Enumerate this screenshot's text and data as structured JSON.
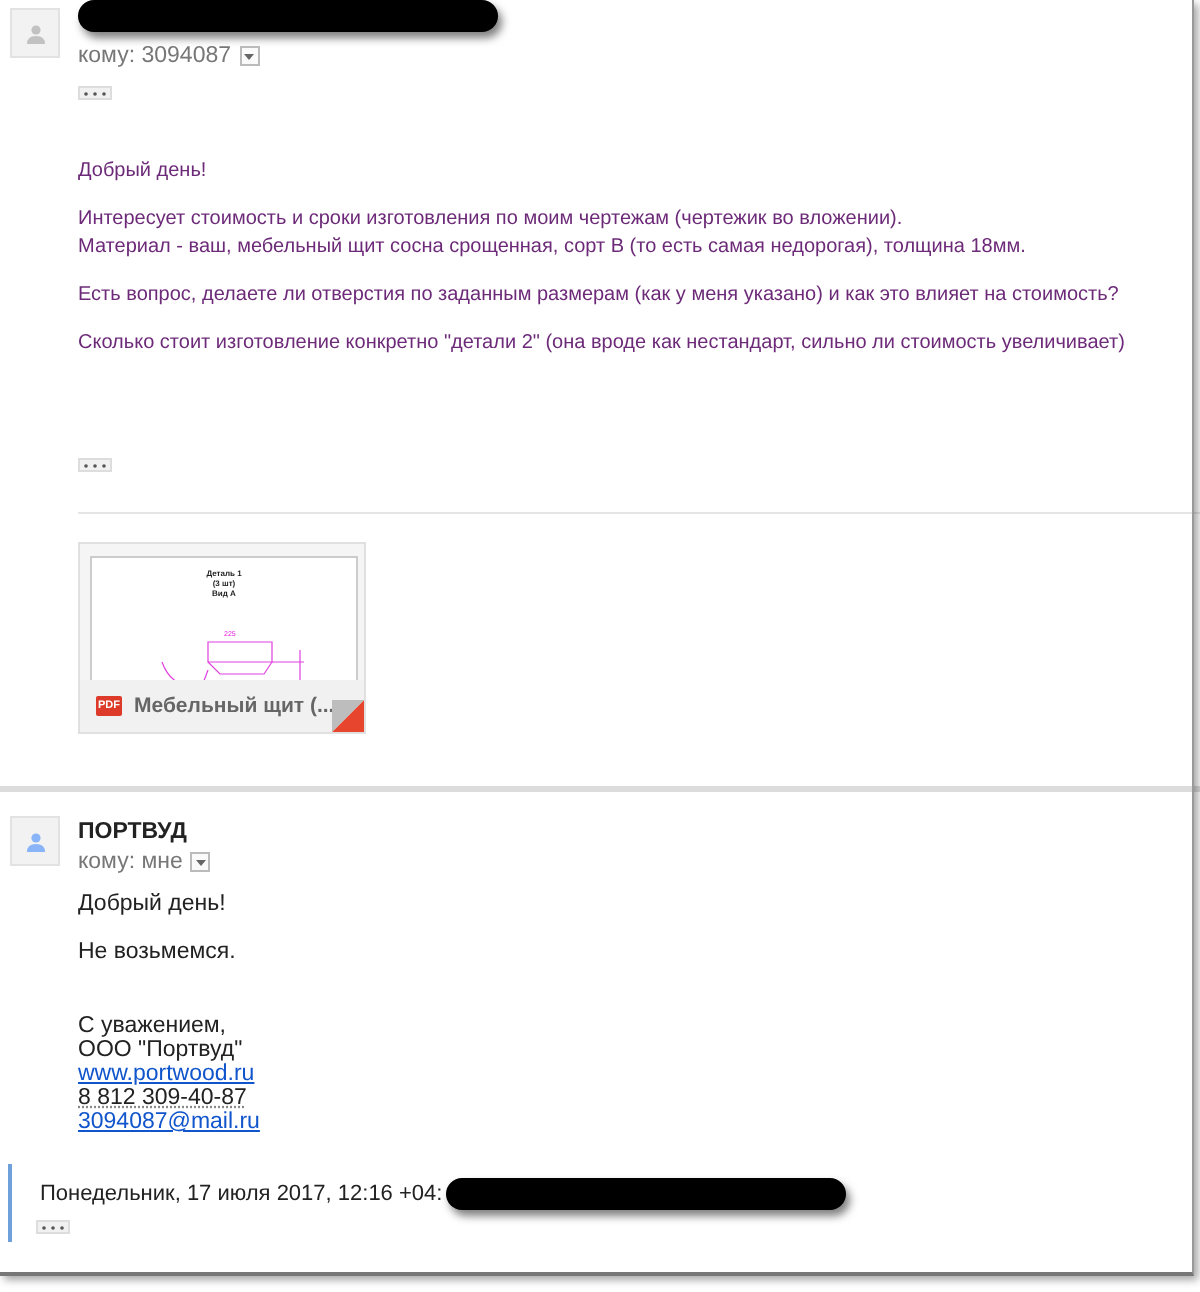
{
  "first_message": {
    "recipient": "кому: 3094087",
    "body": [
      [
        "Добрый день!"
      ],
      [
        "Интересует стоимость и сроки изготовления по моим чертежам (чертежик во вложении).",
        "Материал - ваш, мебельный щит сосна срощенная, сорт В (то есть самая недорогая), толщина 18мм."
      ],
      [
        "Есть вопрос, делаете ли отверстия по заданным размерам (как у меня указано) и как это влияет на стоимость?"
      ],
      [
        "Сколько стоит изготовление конкретно \"детали 2\" (она вроде как нестандарт, сильно ли стоимость увеличивает)"
      ]
    ],
    "attachment": {
      "name": "Мебельный щит (...",
      "file_type": "PDF",
      "preview_lines": [
        "Деталь 1",
        "(3 шт)",
        "Вид А"
      ],
      "preview_dimension": "225"
    }
  },
  "second_message": {
    "sender": "ПОРТВУД",
    "recipient": "кому: мне",
    "body": [
      [
        "Добрый день!"
      ],
      [
        "Не возьмемся."
      ]
    ],
    "signature": [
      {
        "kind": "text",
        "text": "С уважением,"
      },
      {
        "kind": "text",
        "text": "ООО \"Портвуд\""
      },
      {
        "kind": "link",
        "text": "www.portwood.ru"
      },
      {
        "kind": "phone",
        "text": "8 812 309-40-87"
      },
      {
        "kind": "link",
        "text": "3094087@mail.ru"
      }
    ],
    "quote_header": "Понедельник, 17 июля 2017, 12:16 +04:"
  }
}
